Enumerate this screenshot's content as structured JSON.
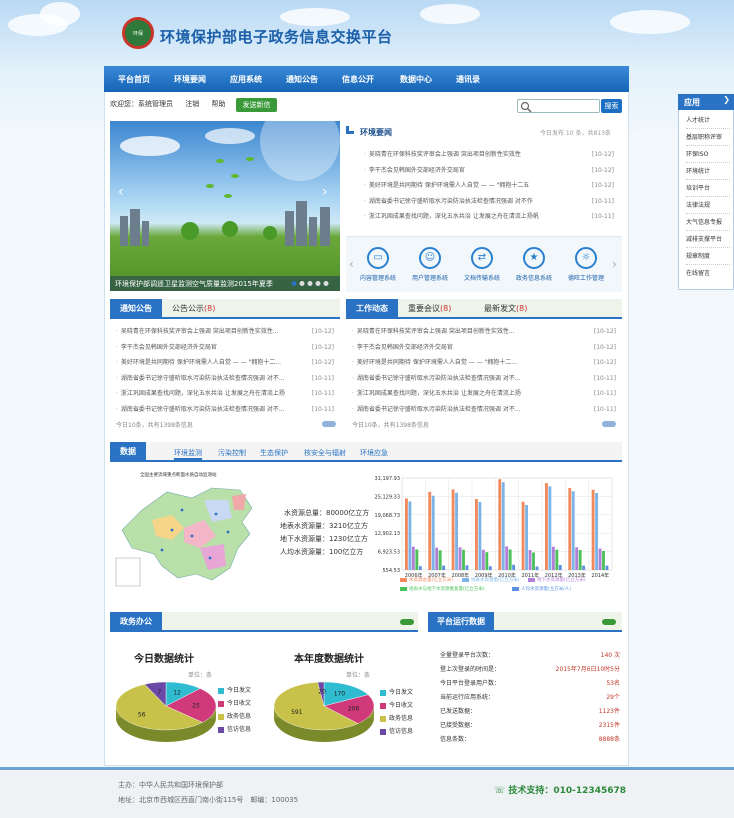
{
  "header": {
    "title": "环境保护部电子政务信息交换平台",
    "logo_text": "环保"
  },
  "nav": [
    "平台首页",
    "环境要闻",
    "应用系统",
    "通知公告",
    "信息公开",
    "数据中心",
    "通讯录"
  ],
  "util": {
    "welcome": "欢迎您：系统管理员",
    "logout": "注销",
    "help": "帮助",
    "send_button": "发送新信"
  },
  "search": {
    "placeholder": "",
    "button": "搜索"
  },
  "banner": {
    "caption": "环境保护部调遥卫星监测空气质量监测2015年夏季"
  },
  "env_news": {
    "title": "环境要闻",
    "meta": "今日发布 10 条，共813条",
    "items": [
      {
        "text": "吴晓青在环保科技奖评审会上强调 突出项目创新性实效性",
        "date": "[10-12]"
      },
      {
        "text": "李干杰会见韩国外交部经济外交局官",
        "date": "[10-12]"
      },
      {
        "text": "美好环境是共同期待 保护环境需人人自觉 — — \"拥抱十二五",
        "date": "[10-12]"
      },
      {
        "text": "湖南省委书记徐守盛听取水污染防治执法检查情况强调 对不作",
        "date": "[10-11]"
      },
      {
        "text": "浙江巩固成果查找问题，深化五水共治 让发展之舟在清流上扬帆",
        "date": "[10-11]"
      }
    ]
  },
  "quick_links": [
    "内容管理系统",
    "用户管理系统",
    "文档传输系统",
    "政务信息系统",
    "德旺工作管理"
  ],
  "notice": {
    "tab_active": "通知公告",
    "tab_other": "公告公示",
    "tab_other_count": "(8)",
    "items": [
      {
        "text": "吴晓青在环保科技奖评审会上强调 突出项目创新性实效性...",
        "date": "[10-12]"
      },
      {
        "text": "李干杰会见韩国外交部经济外交局官",
        "date": "[10-12]"
      },
      {
        "text": "美好环境是共同期待 保护环境需人人自觉 — — \"拥抱十二...",
        "date": "[10-12]"
      },
      {
        "text": "湖南省委书记徐守盛听取水污染防治执法检查情况强调 对不...",
        "date": "[10-11]"
      },
      {
        "text": "浙江巩固成果查找问题，深化五水共治 让发展之舟在清流上扬",
        "date": "[10-11]"
      },
      {
        "text": "湖南省委书记徐守盛听取水污染防治执法检查情况强调 对不...",
        "date": "[10-11]"
      }
    ],
    "footer": "今日10条，共有1398条信息"
  },
  "work": {
    "tab_active": "工作动态",
    "tab2": "重要会议",
    "tab2_count": "(8)",
    "tab3": "最新发文",
    "tab3_count": "(8)",
    "items": [
      {
        "text": "吴晓青在环保科技奖评审会上强调 突出项目创新性实效性...",
        "date": "[10-12]"
      },
      {
        "text": "李干杰会见韩国外交部经济外交局官",
        "date": "[10-12]"
      },
      {
        "text": "美好环境是共同期待 保护环境需人人自觉 — — \"拥抱十二...",
        "date": "[10-12]"
      },
      {
        "text": "湖南省委书记徐守盛听取水污染防治执法检查情况强调 对不...",
        "date": "[10-11]"
      },
      {
        "text": "浙江巩固成果查找问题，深化五水共治 让发展之舟在清流上扬",
        "date": "[10-11]"
      },
      {
        "text": "湖南省委书记徐守盛听取水污染防治执法检查情况强调 对不...",
        "date": "[10-11]"
      }
    ],
    "footer": "今日10条，共有1398条信息"
  },
  "data_center": {
    "tab_active": "数据",
    "tabs": [
      "环境监测",
      "污染控制",
      "生态保护",
      "核安全与辐射",
      "环境应急"
    ],
    "map_title": "全国主要流域重点断面水质自动监测站",
    "stats": [
      {
        "label": "水资源总量：",
        "value": "80000亿立方"
      },
      {
        "label": "地表水资源量：",
        "value": "3210亿立方"
      },
      {
        "label": "地下水资源量：",
        "value": "1230亿立方"
      },
      {
        "label": "人均水资源量：",
        "value": "100亿立方"
      }
    ]
  },
  "chart_data": {
    "type": "bar",
    "categories": [
      "2006年",
      "2007年",
      "2008年",
      "2009年",
      "2010年",
      "2011年",
      "2012年",
      "2013年",
      "2014年"
    ],
    "y_ticks": [
      "554.53",
      "6,923.53",
      "12,902.13",
      "19,068.73",
      "25,129.33",
      "31,197.93"
    ],
    "ylim": [
      554.53,
      31197.93
    ],
    "series": [
      {
        "name": "水资源总量(亿立方米)",
        "color": "#f08a5d",
        "values": [
          24400,
          26600,
          27400,
          24200,
          30800,
          23300,
          29500,
          27900,
          27300
        ]
      },
      {
        "name": "地表水资源量(亿立方米)",
        "color": "#7cb4ea",
        "values": [
          23400,
          25300,
          26300,
          23200,
          29800,
          22200,
          28400,
          26800,
          26200
        ]
      },
      {
        "name": "地下水资源量(亿立方米)",
        "color": "#b07fd6",
        "values": [
          8300,
          8000,
          8100,
          7300,
          8400,
          7200,
          8300,
          8100,
          7700
        ]
      },
      {
        "name": "地表水与地下水资源重复量(亿立方米)",
        "color": "#4cc05a",
        "values": [
          7400,
          7100,
          7300,
          6500,
          7400,
          6400,
          7300,
          7200,
          6900
        ]
      },
      {
        "name": "人均水资源量(立方米/人)",
        "color": "#5b8fe0",
        "values": [
          1800,
          2000,
          2100,
          1800,
          2300,
          1700,
          2200,
          2000,
          2000
        ]
      }
    ]
  },
  "gov_office": {
    "title": "政务办公",
    "today_title": "今日数据统计",
    "year_title": "本年度数据统计",
    "unit": "单位：条",
    "legend": [
      "今日发文",
      "今日收文",
      "政务信息",
      "信访信息"
    ],
    "today_values": [
      12,
      25,
      56,
      7
    ],
    "year_values": [
      170,
      206,
      591,
      20
    ],
    "colors": [
      "#2fbcd0",
      "#d03a7a",
      "#c8c24a",
      "#6a4aa6"
    ]
  },
  "platform": {
    "title": "平台运行数据",
    "rows": [
      {
        "label": "全量登录平台次数：",
        "value": "140 次"
      },
      {
        "label": "登上次登录的时间是：",
        "value": "2015年7月6日10时5分"
      },
      {
        "label": "今日平台登录用户数：",
        "value": "53名"
      },
      {
        "label": "当前运行应用系统：",
        "value": "29个"
      },
      {
        "label": "已发送数据：",
        "value": "1123件"
      },
      {
        "label": "已接受数据：",
        "value": "2315件"
      },
      {
        "label": "信息条数：",
        "value": "8888条"
      }
    ]
  },
  "sidebar": {
    "title": "应用",
    "items": [
      "人才统计",
      "基层职称评审",
      "环保ISO",
      "环境统计",
      "培训平台",
      "法律法规",
      "大气信息专报",
      "减排支撑平台",
      "规章制度",
      "在线留言"
    ]
  },
  "footer": {
    "host": "主办：中华人民共和国环境保护部",
    "address": "地址：北京市西城区西直门南小街115号　邮编：100035",
    "support": "技术支持：010-12345678"
  }
}
